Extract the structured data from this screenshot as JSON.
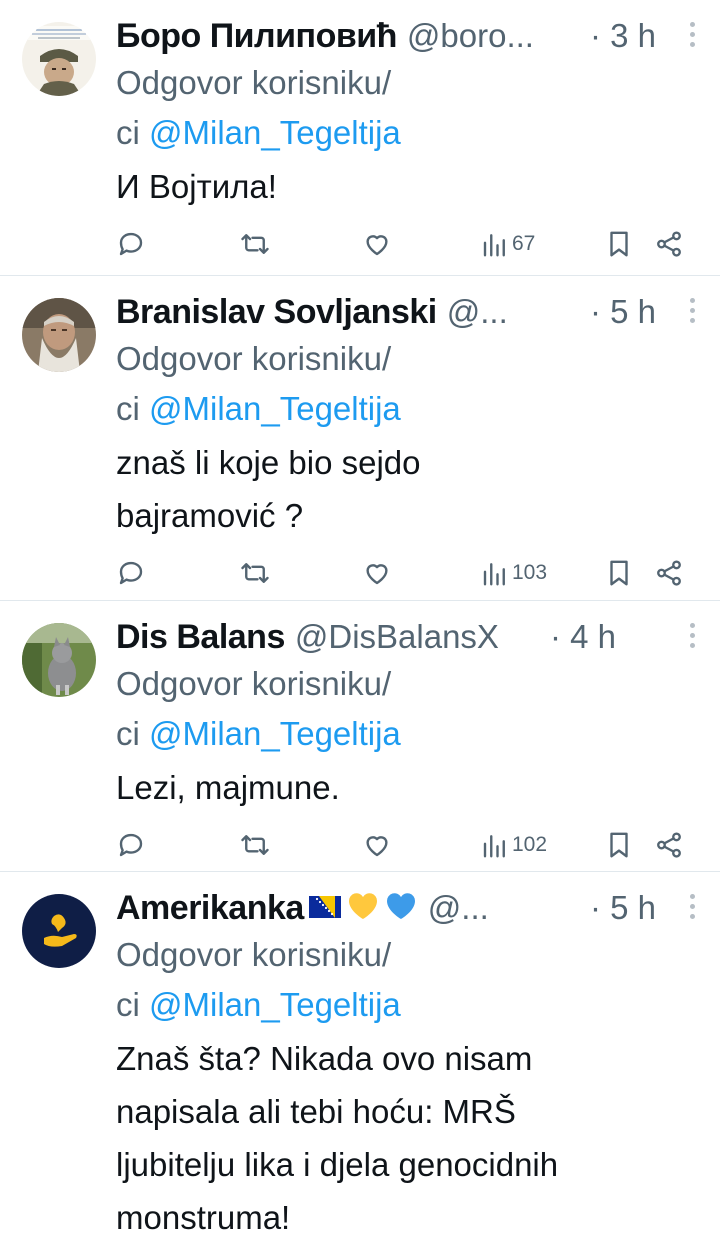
{
  "tweets": [
    {
      "name": "Боро Пилиповић",
      "handle": "@boro...",
      "time": "· 3 h",
      "reply_prefix": "Odgovor korisniku/",
      "reply_prefix2": "ci ",
      "reply_mention": "@Milan_Tegeltija",
      "text_lines": [
        "И Војтила!"
      ],
      "views": "67",
      "avatar": "avatar-soldier"
    },
    {
      "name": "Branislav Sovljanski",
      "handle": "@...",
      "time": "· 5 h",
      "reply_prefix": "Odgovor korisniku/",
      "reply_prefix2": "ci ",
      "reply_mention": "@Milan_Tegeltija",
      "text_lines": [
        "znaš li koje bio sejdo",
        "bajramović ?"
      ],
      "views": "103",
      "avatar": "avatar-bearded-man"
    },
    {
      "name": "Dis Balans",
      "handle": "@DisBalansX",
      "time": "· 4 h",
      "reply_prefix": "Odgovor korisniku/",
      "reply_prefix2": "ci ",
      "reply_mention": "@Milan_Tegeltija",
      "text_lines": [
        "Lezi, majmune."
      ],
      "views": "102",
      "avatar": "avatar-cat"
    },
    {
      "name": "Amerikanka",
      "name_emojis": [
        "bosnia-flag-icon",
        "yellow-heart-icon",
        "blue-heart-icon"
      ],
      "handle": "@...",
      "time": "· 5 h",
      "reply_prefix": "Odgovor korisniku/",
      "reply_prefix2": "ci ",
      "reply_mention": "@Milan_Tegeltija",
      "text_lines": [
        "Znaš šta? Nikada ovo nisam",
        "napisala ali tebi hoću: MRŠ",
        "ljubitelju lika i djela genocidnih",
        "monstruma!"
      ],
      "avatar": "avatar-hand-logo"
    }
  ],
  "colors": {
    "text": "#0f1419",
    "secondary": "#536471",
    "mention": "#1d9bf0",
    "divider": "#e1e8ed"
  }
}
